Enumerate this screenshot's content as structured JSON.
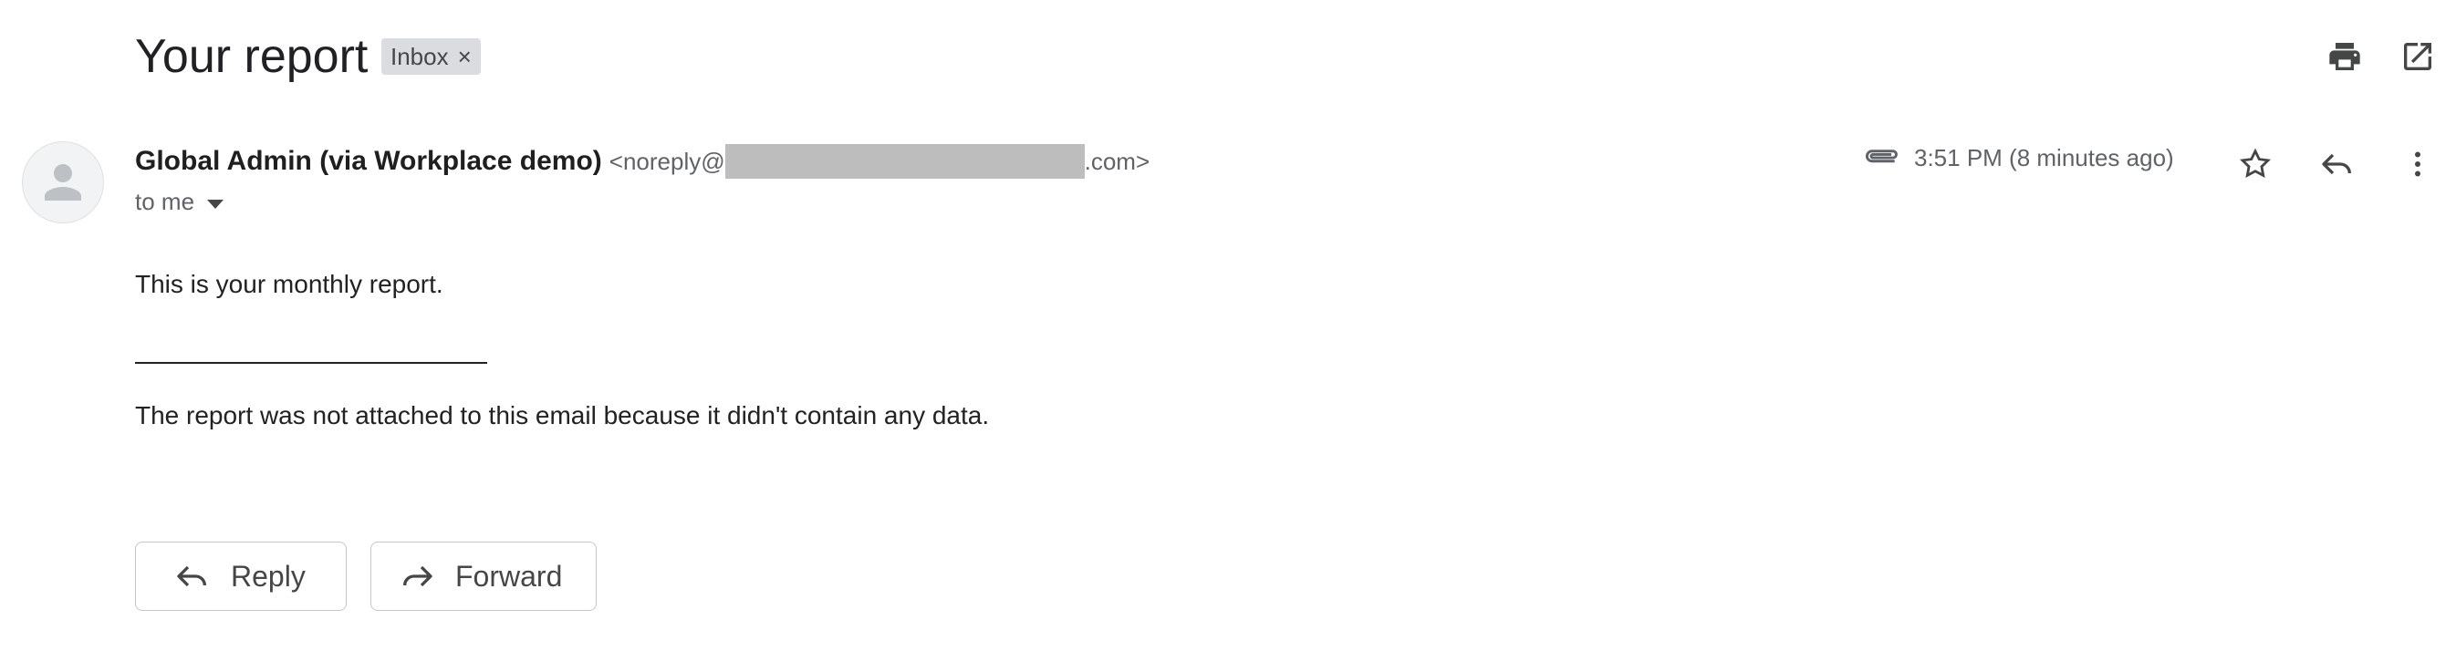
{
  "subject": "Your report",
  "label_chip": {
    "text": "Inbox",
    "remove": "×"
  },
  "toolbar": {
    "print_icon": "print-icon",
    "open_new_window_icon": "open-in-new-icon"
  },
  "sender": {
    "name": "Global Admin (via Workplace demo)",
    "email_prefix": "<noreply@",
    "email_suffix": ".com>",
    "recipient": "to me"
  },
  "meta": {
    "time": "3:51 PM (8 minutes ago)"
  },
  "message": {
    "line1": "This is your monthly report.",
    "line2": "The report was not attached to this email because it didn't contain any data."
  },
  "actions": {
    "reply": "Reply",
    "forward": "Forward"
  },
  "colors": {
    "text": "#202124",
    "muted": "#5f6368",
    "chip": "#dadce0",
    "redaction": "#bdbdbd"
  }
}
